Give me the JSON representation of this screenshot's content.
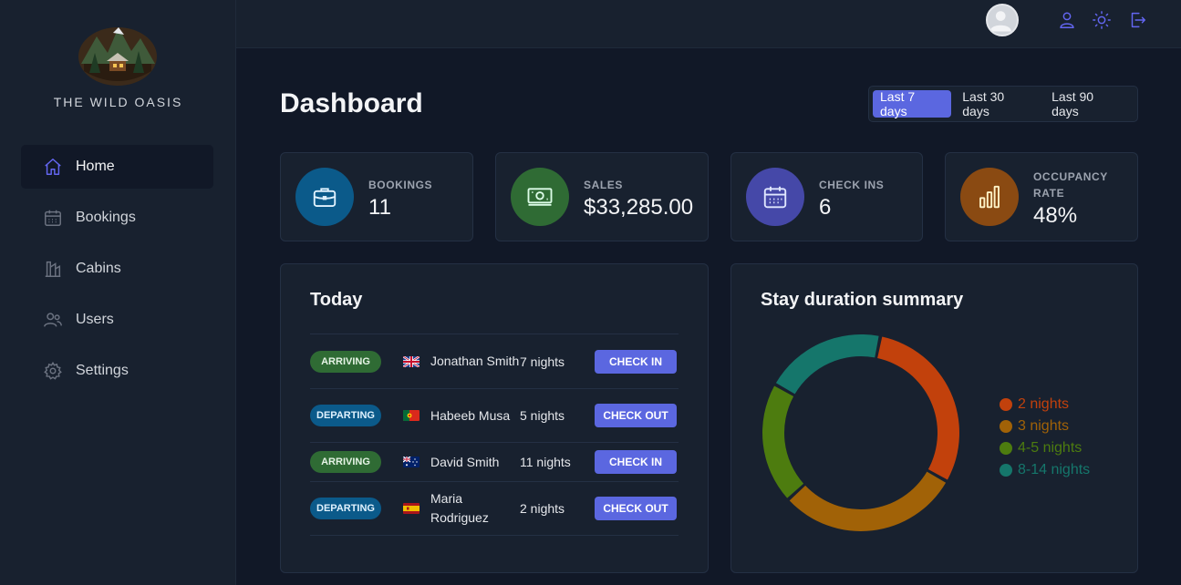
{
  "brand": {
    "name": "THE WILD OASIS"
  },
  "sidebar": {
    "items": [
      {
        "label": "Home",
        "icon": "home-icon",
        "active": true
      },
      {
        "label": "Bookings",
        "icon": "calendar-icon"
      },
      {
        "label": "Cabins",
        "icon": "cabin-icon"
      },
      {
        "label": "Users",
        "icon": "users-icon"
      },
      {
        "label": "Settings",
        "icon": "gear-icon"
      }
    ]
  },
  "header": {
    "icons": [
      "user-icon",
      "sun-icon",
      "logout-icon"
    ]
  },
  "page": {
    "title": "Dashboard"
  },
  "filter": {
    "options": [
      "Last 7 days",
      "Last 30 days",
      "Last 90 days"
    ],
    "active": "Last 7 days"
  },
  "stats": [
    {
      "label": "Bookings",
      "value": "11",
      "icon": "briefcase-icon",
      "color": "#0b5a8a"
    },
    {
      "label": "Sales",
      "value": "$33,285.00",
      "icon": "banknotes-icon",
      "color": "#2f6b34"
    },
    {
      "label": "Check ins",
      "value": "6",
      "icon": "calendar-days-icon",
      "color": "#4548a8"
    },
    {
      "label": "Occupancy rate",
      "value": "48%",
      "icon": "chart-bar-icon",
      "color": "#8a4a12"
    }
  ],
  "today": {
    "title": "Today",
    "rows": [
      {
        "status": "Arriving",
        "flag": "uk-flag-icon",
        "guest": "Jonathan Smith",
        "nights": "7 nights",
        "action": "Check in"
      },
      {
        "status": "Departing",
        "flag": "portugal-flag-icon",
        "guest": "Habeeb Musa",
        "nights": "5 nights",
        "action": "Check out"
      },
      {
        "status": "Arriving",
        "flag": "australia-flag-icon",
        "guest": "David Smith",
        "nights": "11 nights",
        "action": "Check in"
      },
      {
        "status": "Departing",
        "flag": "spain-flag-icon",
        "guest": "Maria Rodriguez",
        "nights": "2 nights",
        "action": "Check out"
      }
    ]
  },
  "stay": {
    "title": "Stay duration summary"
  },
  "chart_data": {
    "type": "pie",
    "categories": [
      "2 nights",
      "3 nights",
      "4-5 nights",
      "8-14 nights"
    ],
    "values": [
      3,
      3,
      2,
      2
    ],
    "colors": [
      "#c2410c",
      "#a16207",
      "#4d7c0f",
      "#15766b"
    ],
    "legend": "right"
  }
}
